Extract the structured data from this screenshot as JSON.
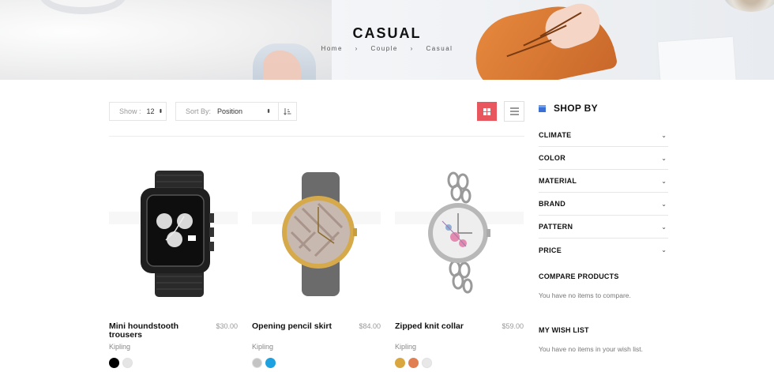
{
  "banner": {
    "title": "CASUAL",
    "breadcrumb": [
      "Home",
      "Couple",
      "Casual"
    ],
    "separator": "›"
  },
  "toolbar": {
    "show_label": "Show :",
    "show_value": "12",
    "sort_label": "Sort By:",
    "sort_value": "Position",
    "select_arrow": "⬍",
    "sort_direction_icon": "sort-ascending-icon",
    "grid_view_icon": "grid-view-icon",
    "list_view_icon": "list-view-icon",
    "active_color": "#e8575d"
  },
  "products": [
    {
      "name": "Mini houndstooth trousers",
      "price": "$30.00",
      "brand": "Kipling",
      "swatches": [
        "#000000",
        "#e5e5e5"
      ],
      "image": "black-chronograph-watch"
    },
    {
      "name": "Opening pencil skirt",
      "price": "$84.00",
      "brand": "Kipling",
      "swatches": [
        "#c4c4c4",
        "#1da1e0"
      ],
      "image": "gold-gray-strap-watch"
    },
    {
      "name": "Zipped knit collar",
      "price": "$59.00",
      "brand": "Kipling",
      "swatches": [
        "#d9a73e",
        "#e07f52",
        "#e8e8e8"
      ],
      "image": "silver-chain-floral-watch"
    }
  ],
  "sidebar": {
    "shop_by": "SHOP BY",
    "filters": [
      "CLIMATE",
      "COLOR",
      "MATERIAL",
      "BRAND",
      "PATTERN",
      "PRICE"
    ],
    "chevron": "⌄",
    "compare_title": "COMPARE PRODUCTS",
    "compare_text": "You have no items to compare.",
    "wishlist_title": "MY WISH LIST",
    "wishlist_text": "You have no items in your wish list."
  }
}
